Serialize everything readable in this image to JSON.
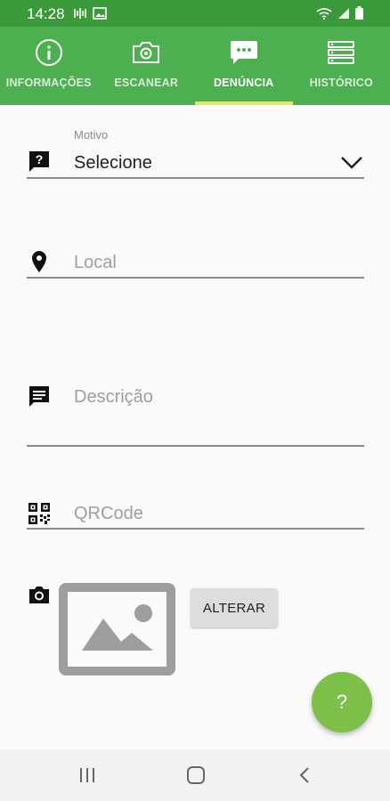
{
  "status_bar": {
    "time": "14:28",
    "left_icons": [
      "signal-indicator-icon",
      "gallery-icon"
    ],
    "right_icons": [
      "wifi-icon",
      "cell-signal-icon",
      "battery-icon"
    ]
  },
  "tabs": [
    {
      "label": "INFORMAÇÕES",
      "icon": "info-icon",
      "active": false
    },
    {
      "label": "ESCANEAR",
      "icon": "camera-icon",
      "active": false
    },
    {
      "label": "DENÚNCIA",
      "icon": "chat-bubble-icon",
      "active": true
    },
    {
      "label": "HISTÓRICO",
      "icon": "list-icon",
      "active": false
    }
  ],
  "form": {
    "motivo": {
      "label": "Motivo",
      "value": "Selecione",
      "icon": "report-icon"
    },
    "local": {
      "placeholder": "Local",
      "icon": "location-pin-icon"
    },
    "descricao": {
      "placeholder": "Descrição",
      "icon": "comment-icon"
    },
    "qrcode": {
      "placeholder": "QRCode",
      "icon": "qrcode-icon"
    },
    "photo": {
      "icon": "camera-icon",
      "button_label": "ALTERAR",
      "placeholder_icon": "image-placeholder-icon"
    }
  },
  "fab": {
    "label": "?"
  },
  "colors": {
    "primary": "#4caf50",
    "status_bar": "#3a9a3a",
    "tab_indicator": "#dde86a",
    "fab": "#7cc04a"
  }
}
